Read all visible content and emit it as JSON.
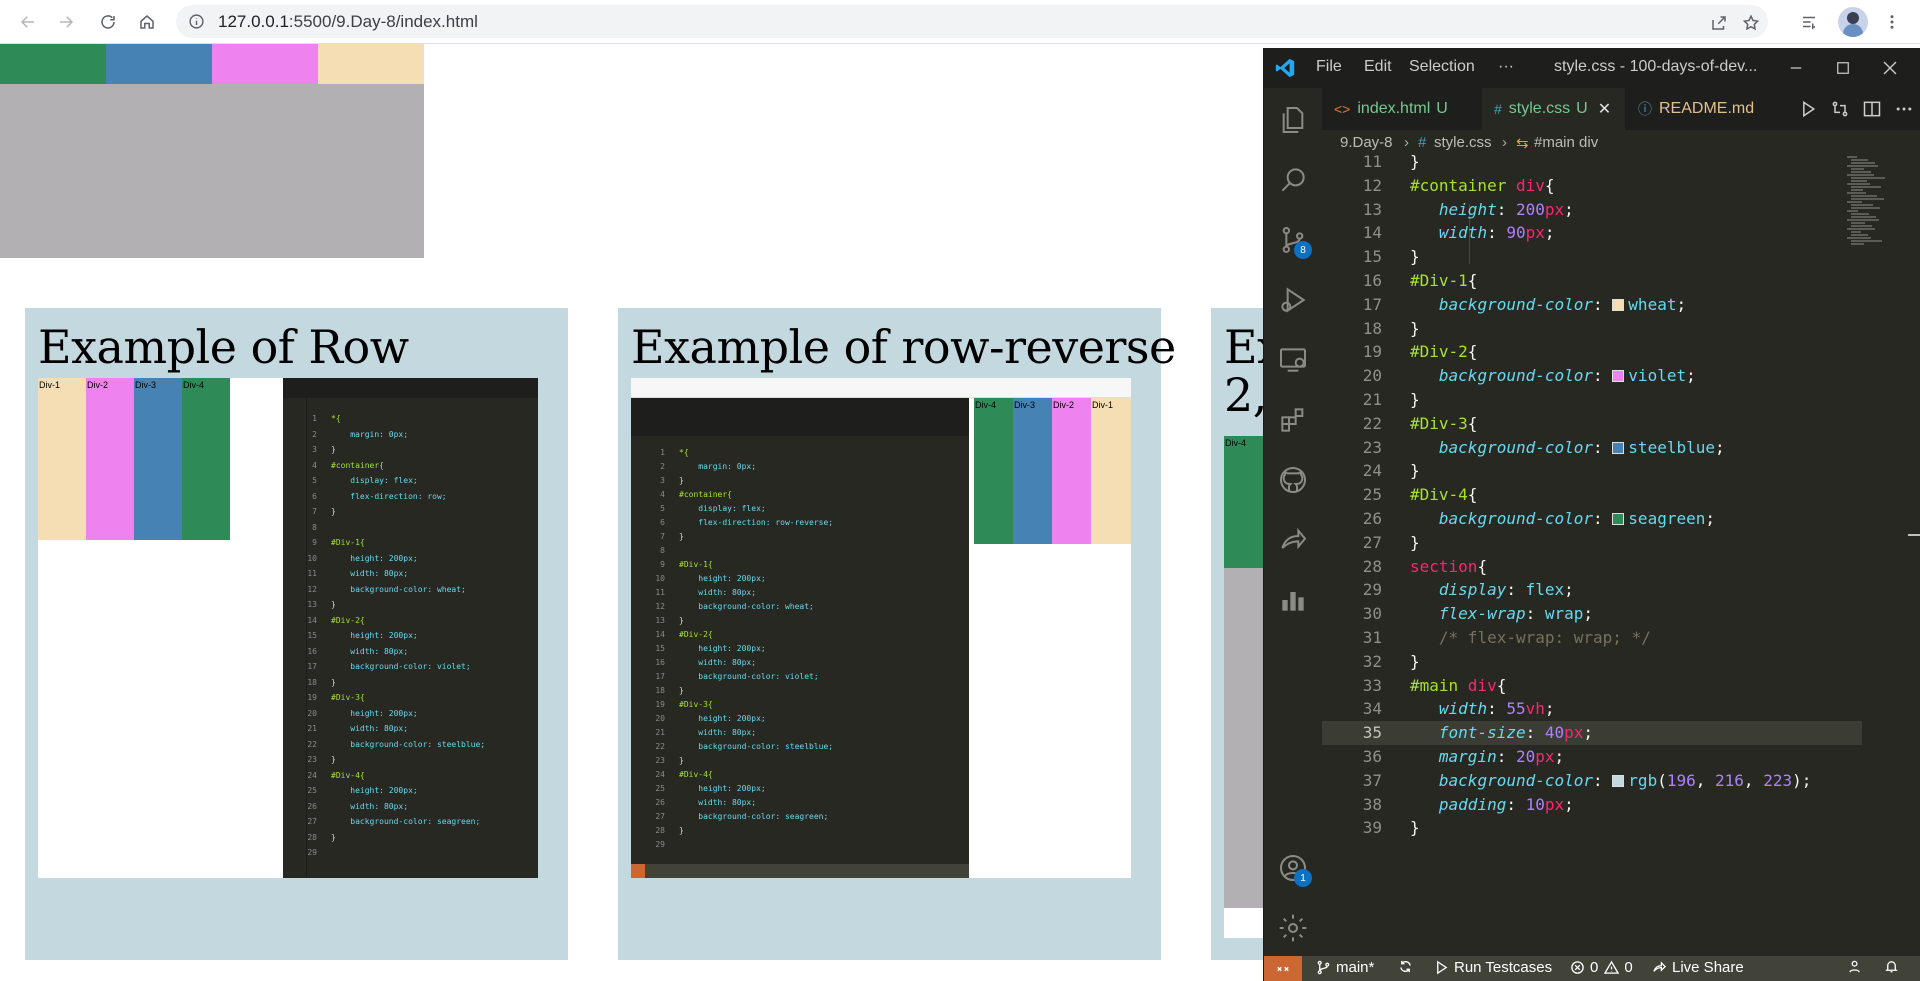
{
  "browser": {
    "url_host": "127.0.0.1",
    "url_path": ":5500/9.Day-8/index.html"
  },
  "page": {
    "top_strip_colors": [
      "#2e8b57",
      "#4682b4",
      "#ee82ee",
      "#f5deb3"
    ],
    "card_bg": "#c4d8df",
    "cards": [
      {
        "title": "Example of Row",
        "divs": [
          "Div-1",
          "Div-2",
          "Div-3",
          "Div-4"
        ],
        "code": [
          {
            "n": "1",
            "t": "*{"
          },
          {
            "n": "2",
            "t": "    margin: 0px;"
          },
          {
            "n": "3",
            "t": "}"
          },
          {
            "n": "4",
            "t": "#container{"
          },
          {
            "n": "5",
            "t": "    display: flex;"
          },
          {
            "n": "6",
            "t": "    flex-direction: row;"
          },
          {
            "n": "7",
            "t": "}"
          },
          {
            "n": "8",
            "t": ""
          },
          {
            "n": "9",
            "t": "#Div-1{"
          },
          {
            "n": "10",
            "t": "    height: 200px;"
          },
          {
            "n": "11",
            "t": "    width: 80px;"
          },
          {
            "n": "12",
            "t": "    background-color: wheat;"
          },
          {
            "n": "13",
            "t": "}"
          },
          {
            "n": "14",
            "t": "#Div-2{"
          },
          {
            "n": "15",
            "t": "    height: 200px;"
          },
          {
            "n": "16",
            "t": "    width: 80px;"
          },
          {
            "n": "17",
            "t": "    background-color: violet;"
          },
          {
            "n": "18",
            "t": "}"
          },
          {
            "n": "19",
            "t": "#Div-3{"
          },
          {
            "n": "20",
            "t": "    height: 200px;"
          },
          {
            "n": "21",
            "t": "    width: 80px;"
          },
          {
            "n": "22",
            "t": "    background-color: steelblue;"
          },
          {
            "n": "23",
            "t": "}"
          },
          {
            "n": "24",
            "t": "#Div-4{"
          },
          {
            "n": "25",
            "t": "    height: 200px;"
          },
          {
            "n": "26",
            "t": "    width: 80px;"
          },
          {
            "n": "27",
            "t": "    background-color: seagreen;"
          },
          {
            "n": "28",
            "t": "}"
          },
          {
            "n": "29",
            "t": ""
          }
        ]
      },
      {
        "title": "Example of row-reverse",
        "divs": [
          "Div-4",
          "Div-3",
          "Div-2",
          "Div-1"
        ],
        "code": [
          {
            "n": "1",
            "t": "*{"
          },
          {
            "n": "2",
            "t": "    margin: 0px;"
          },
          {
            "n": "3",
            "t": "}"
          },
          {
            "n": "4",
            "t": "#container{"
          },
          {
            "n": "5",
            "t": "    display: flex;"
          },
          {
            "n": "6",
            "t": "    flex-direction: row-reverse;"
          },
          {
            "n": "7",
            "t": "}"
          },
          {
            "n": "8",
            "t": ""
          },
          {
            "n": "9",
            "t": "#Div-1{"
          },
          {
            "n": "10",
            "t": "    height: 200px;"
          },
          {
            "n": "11",
            "t": "    width: 80px;"
          },
          {
            "n": "12",
            "t": "    background-color: wheat;"
          },
          {
            "n": "13",
            "t": "}"
          },
          {
            "n": "14",
            "t": "#Div-2{"
          },
          {
            "n": "15",
            "t": "    height: 200px;"
          },
          {
            "n": "16",
            "t": "    width: 80px;"
          },
          {
            "n": "17",
            "t": "    background-color: violet;"
          },
          {
            "n": "18",
            "t": "}"
          },
          {
            "n": "19",
            "t": "#Div-3{"
          },
          {
            "n": "20",
            "t": "    height: 200px;"
          },
          {
            "n": "21",
            "t": "    width: 80px;"
          },
          {
            "n": "22",
            "t": "    background-color: steelblue;"
          },
          {
            "n": "23",
            "t": "}"
          },
          {
            "n": "24",
            "t": "#Div-4{"
          },
          {
            "n": "25",
            "t": "    height: 200px;"
          },
          {
            "n": "26",
            "t": "    width: 80px;"
          },
          {
            "n": "27",
            "t": "    background-color: seagreen;"
          },
          {
            "n": "28",
            "t": "}"
          },
          {
            "n": "29",
            "t": ""
          }
        ]
      },
      {
        "title_line1": "Ex",
        "title_line2": "2,",
        "divs": [
          "Div-4"
        ]
      }
    ]
  },
  "vscode": {
    "menu": [
      "File",
      "Edit",
      "Selection",
      "···"
    ],
    "window_title": "style.css - 100-days-of-dev...",
    "tabs": [
      {
        "label": "index.html",
        "status": "U",
        "icon": "<>",
        "icon_color": "#e37933",
        "label_color": "#73c991"
      },
      {
        "label": "style.css",
        "status": "U",
        "icon": "#",
        "icon_color": "#519aba",
        "label_color": "#73c991"
      },
      {
        "label": "README.md",
        "status": "",
        "icon": "ⓘ",
        "icon_color": "#519aba",
        "label_color": "#e2c08d"
      }
    ],
    "breadcrumb": [
      "9.Day-8",
      "style.css",
      "#main div"
    ],
    "scm_badge": "8",
    "account_badge": "1",
    "status": {
      "branch": "main*",
      "run": "Run Testcases",
      "errors": "0",
      "warnings": "0",
      "live_share": "Live Share"
    },
    "current_line": "35"
  }
}
